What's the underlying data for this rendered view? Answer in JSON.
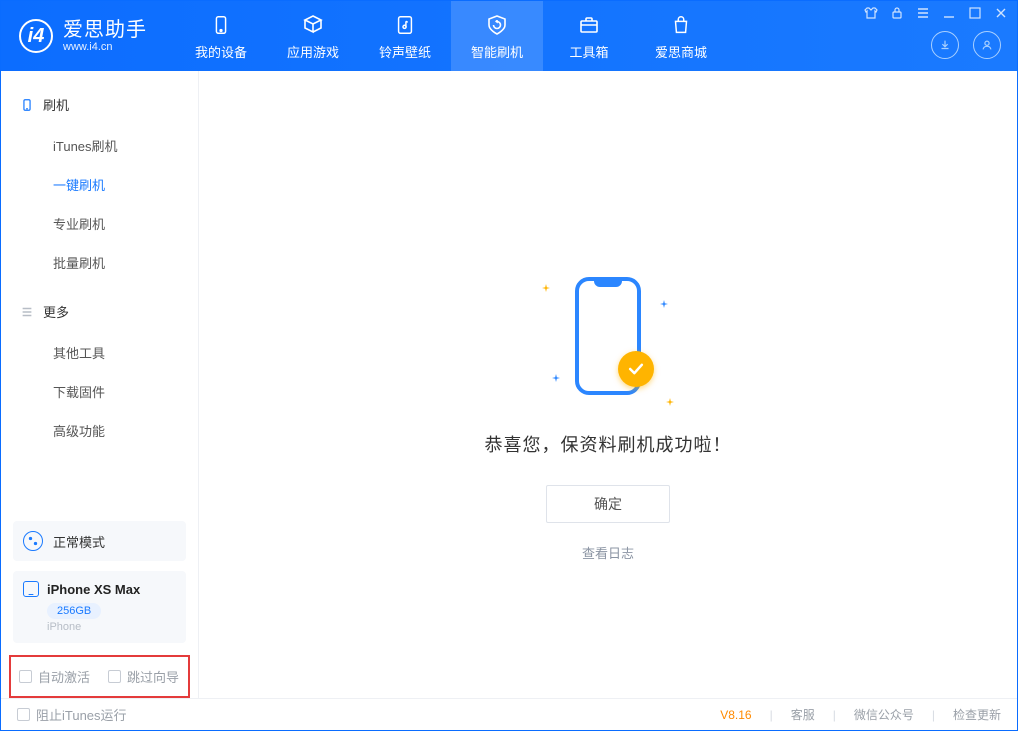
{
  "brand": {
    "name": "爱思助手",
    "url": "www.i4.cn"
  },
  "nav": {
    "items": [
      {
        "label": "我的设备"
      },
      {
        "label": "应用游戏"
      },
      {
        "label": "铃声壁纸"
      },
      {
        "label": "智能刷机"
      },
      {
        "label": "工具箱"
      },
      {
        "label": "爱思商城"
      }
    ],
    "active_index": 3
  },
  "sidebar": {
    "group1": {
      "title": "刷机",
      "items": [
        "iTunes刷机",
        "一键刷机",
        "专业刷机",
        "批量刷机"
      ],
      "active_index": 1
    },
    "group2": {
      "title": "更多",
      "items": [
        "其他工具",
        "下载固件",
        "高级功能"
      ]
    }
  },
  "device": {
    "mode_label": "正常模式",
    "name": "iPhone XS Max",
    "capacity": "256GB",
    "type": "iPhone"
  },
  "options": {
    "auto_activate": "自动激活",
    "skip_guide": "跳过向导"
  },
  "result": {
    "title": "恭喜您，保资料刷机成功啦！",
    "ok": "确定",
    "view_log": "查看日志"
  },
  "statusbar": {
    "block_itunes": "阻止iTunes运行",
    "version": "V8.16",
    "support": "客服",
    "wechat": "微信公众号",
    "check_update": "检查更新"
  }
}
